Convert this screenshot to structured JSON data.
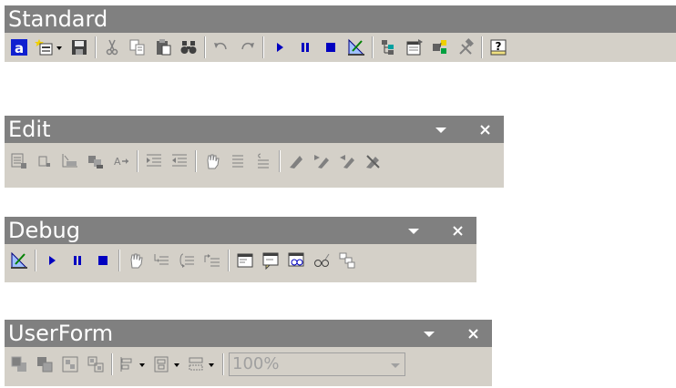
{
  "toolbars": {
    "standard": {
      "title": "Standard"
    },
    "edit": {
      "title": "Edit",
      "menu_icon": "dropdown-arrow-icon",
      "close_icon": "close-icon"
    },
    "debug": {
      "title": "Debug",
      "menu_icon": "dropdown-arrow-icon",
      "close_icon": "close-icon"
    },
    "userform": {
      "title": "UserForm",
      "menu_icon": "dropdown-arrow-icon",
      "close_icon": "close-icon",
      "zoom_value": "100%"
    }
  },
  "colors": {
    "title_bar": "#808080",
    "toolbar_face": "#d4d0c8",
    "run_blue": "#0000c0",
    "disabled_gray": "#a0a0a0"
  }
}
